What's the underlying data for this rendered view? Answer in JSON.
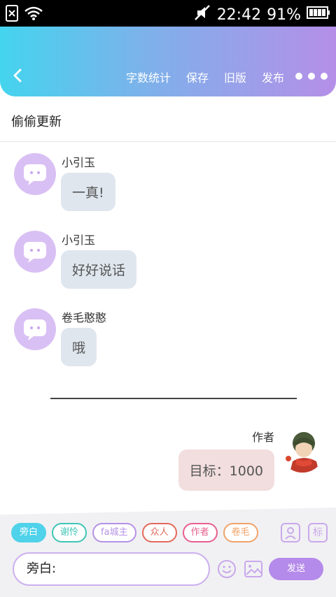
{
  "status_bar": {
    "time": "22:42",
    "battery": "91%"
  },
  "header": {
    "back_icon": "chevron-left-icon",
    "actions": [
      "字数统计",
      "保存",
      "旧版",
      "发布"
    ],
    "more_icon": "more-dots-icon"
  },
  "document": {
    "title": "偷偷更新"
  },
  "messages": [
    {
      "sender": "小引玉",
      "text": "一真!"
    },
    {
      "sender": "小引玉",
      "text": "好好说话"
    },
    {
      "sender": "卷毛憨憨",
      "text": "哦"
    }
  ],
  "author_message": {
    "sender": "作者",
    "text": "目标：1000"
  },
  "role_tags": [
    {
      "label": "旁白",
      "color": "#4fd2ea"
    },
    {
      "label": "谢怜",
      "color": "#3fc6b6"
    },
    {
      "label": "fa城主",
      "color": "#b592e6"
    },
    {
      "label": "众人",
      "color": "#e26a5a"
    },
    {
      "label": "作者",
      "color": "#e85f8f"
    },
    {
      "label": "卷毛",
      "color": "#f0a36a"
    }
  ],
  "side_buttons": {
    "user_icon": "user-icon",
    "tag_label": "标"
  },
  "input": {
    "value": "旁白:"
  },
  "send_button": {
    "label": "发送"
  }
}
